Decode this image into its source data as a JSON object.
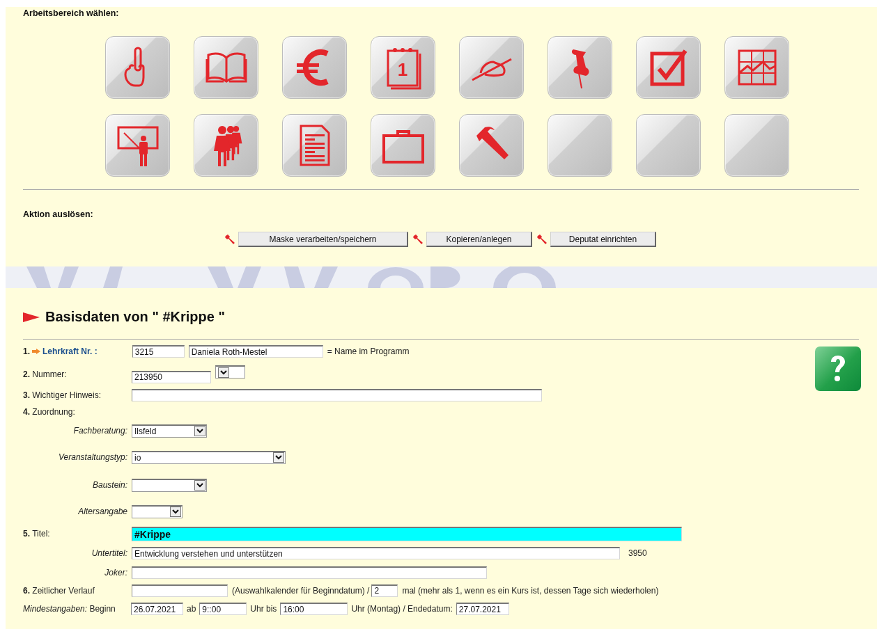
{
  "workspace": {
    "heading": "Arbeitsbereich wählen:",
    "tiles": [
      {
        "kind": "finger"
      },
      {
        "kind": "book"
      },
      {
        "kind": "euro"
      },
      {
        "kind": "calendar",
        "label": "1"
      },
      {
        "kind": "signature"
      },
      {
        "kind": "pin"
      },
      {
        "kind": "checkbox"
      },
      {
        "kind": "chart"
      },
      {
        "kind": "teacher"
      },
      {
        "kind": "people"
      },
      {
        "kind": "document"
      },
      {
        "kind": "briefcase"
      },
      {
        "kind": "hammer"
      },
      {
        "kind": "empty"
      },
      {
        "kind": "empty"
      },
      {
        "kind": "empty"
      }
    ]
  },
  "actions": {
    "heading": "Aktion auslösen:",
    "buttons": [
      {
        "label": "Maske verarbeiten/speichern"
      },
      {
        "label": "Kopieren/anlegen"
      },
      {
        "label": "Deputat einrichten"
      }
    ]
  },
  "section_title": "Basisdaten von \" #Krippe \"",
  "form": {
    "teacher": {
      "number": "1.",
      "label": "Lehrkraft Nr. :",
      "id_value": "3215",
      "name_value": "Daniela Roth-Mestel",
      "note": "= Name im Programm"
    },
    "nummer": {
      "label": "**2.** Nummer:",
      "value": "213950"
    },
    "hinweis": {
      "label": "**3.** Wichtiger Hinweis:"
    },
    "zuordnung": {
      "label": "**4.** Zuordnung:",
      "selects": [
        {
          "label": "Fachberatung:",
          "value": "Ilsfeld"
        },
        {
          "label": "Veranstaltungstyp:",
          "value": "io"
        },
        {
          "label": "Baustein:"
        },
        {
          "label": "Altersangabe"
        }
      ]
    },
    "titel": {
      "label": "**5.** Titel:",
      "value": "#Krippe"
    },
    "untertitel": {
      "label": "Untertitel:",
      "value": "Entwicklung verstehen und unterstützen",
      "note": "3950"
    },
    "joker": {
      "label": "Joker:"
    },
    "zeit": {
      "label": "**6.** Zeitlicher Verlauf",
      "calendar_note": "(Auswahlkalender für Beginndatum) /",
      "count": "2",
      "count_note": "mal (mehr als 1, wenn es ein Kurs ist, dessen Tage sich wiederholen)"
    },
    "mindest": {
      "label": "*Mindestangaben:* Beginn",
      "start_date": "26.07.2021",
      "from_label": "ab",
      "from_time": "9::00",
      "to_label": "Uhr bis",
      "to_time": "16:00",
      "end_label": "Uhr (Montag) / Endedatum:",
      "end_date": "27.07.2021"
    }
  }
}
